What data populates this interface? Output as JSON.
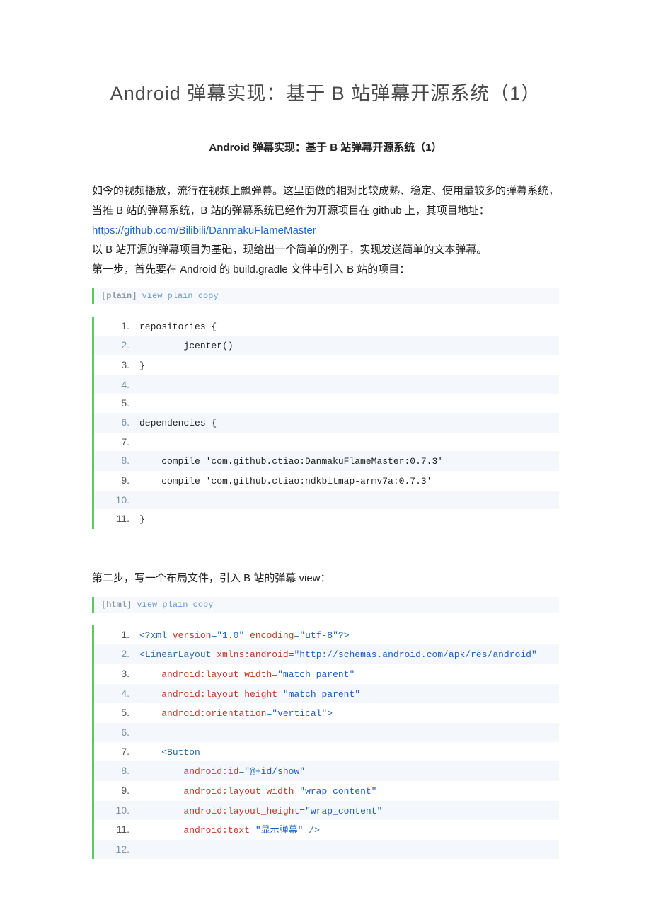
{
  "title": "Android 弹幕实现：基于 B 站弹幕开源系统（1）",
  "subtitle": "Android 弹幕实现：基于 B 站弹幕开源系统（1）",
  "intro": {
    "p1a": "如今的视频播放，流行在视频上飘弹幕。这里面做的相对比较成熟、稳定、使用量较多的弹幕系统，当推 B 站的弹幕系统，B 站的弹幕系统已经作为开源项目在 github 上，其项目地址：",
    "link": "https://github.com/Bilibili/DanmakuFlameMaster",
    "p2": "以 B 站开源的弹幕项目为基础，现给出一个简单的例子，实现发送简单的文本弹幕。",
    "p3": "第一步，首先要在 Android 的 build.gradle 文件中引入 B 站的项目："
  },
  "block1": {
    "langLabel": "[plain]",
    "viewPlain": "view plain",
    "copy": "copy",
    "lines": [
      "repositories {",
      "        jcenter()",
      "}",
      "",
      "",
      "dependencies {",
      "",
      "    compile 'com.github.ctiao:DanmakuFlameMaster:0.7.3'",
      "    compile 'com.github.ctiao:ndkbitmap-armv7a:0.7.3'",
      "",
      "}"
    ]
  },
  "step2": "第二步，写一个布局文件，引入 B 站的弹幕 view：",
  "block2": {
    "langLabel": "[html]",
    "viewPlain": "view plain",
    "copy": "copy"
  },
  "chart_data": {
    "type": "table",
    "title": "XML layout code (block2)",
    "lines": [
      {
        "n": 1,
        "code": "<?xml version=\"1.0\" encoding=\"utf-8\"?>"
      },
      {
        "n": 2,
        "code": "<LinearLayout xmlns:android=\"http://schemas.android.com/apk/res/android\""
      },
      {
        "n": 3,
        "code": "    android:layout_width=\"match_parent\""
      },
      {
        "n": 4,
        "code": "    android:layout_height=\"match_parent\""
      },
      {
        "n": 5,
        "code": "    android:orientation=\"vertical\">"
      },
      {
        "n": 6,
        "code": ""
      },
      {
        "n": 7,
        "code": "    <Button"
      },
      {
        "n": 8,
        "code": "        android:id=\"@+id/show\""
      },
      {
        "n": 9,
        "code": "        android:layout_width=\"wrap_content\""
      },
      {
        "n": 10,
        "code": "        android:layout_height=\"wrap_content\""
      },
      {
        "n": 11,
        "code": "        android:text=\"显示弹幕\" />"
      },
      {
        "n": 12,
        "code": ""
      }
    ]
  }
}
